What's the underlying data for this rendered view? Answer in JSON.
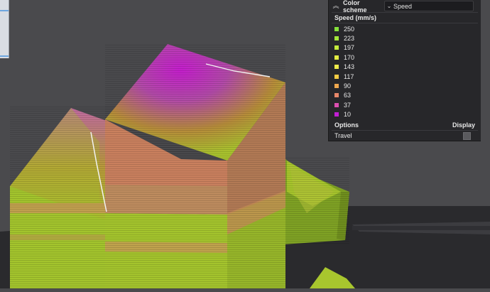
{
  "legend": {
    "color_scheme_label": "Color scheme",
    "selected_scheme": "Speed",
    "speed_title": "Speed (mm/s)",
    "items": [
      {
        "value": "250",
        "color": "#86e23a"
      },
      {
        "value": "223",
        "color": "#a4e63a"
      },
      {
        "value": "197",
        "color": "#c4ea3c"
      },
      {
        "value": "170",
        "color": "#e2ec42"
      },
      {
        "value": "143",
        "color": "#eeea4a"
      },
      {
        "value": "117",
        "color": "#f3cc44"
      },
      {
        "value": "90",
        "color": "#efa84e"
      },
      {
        "value": "63",
        "color": "#e8876a"
      },
      {
        "value": "37",
        "color": "#dc4fb0"
      },
      {
        "value": "10",
        "color": "#c21ed4"
      }
    ],
    "options_label": "Options",
    "display_label": "Display",
    "travel_label": "Travel"
  },
  "colors": {
    "background": "#4a4a4d",
    "panel": "#27272a",
    "model_green": "#a8cc2e",
    "model_salmon": "#c97e5e",
    "model_magenta": "#b62ac0"
  }
}
